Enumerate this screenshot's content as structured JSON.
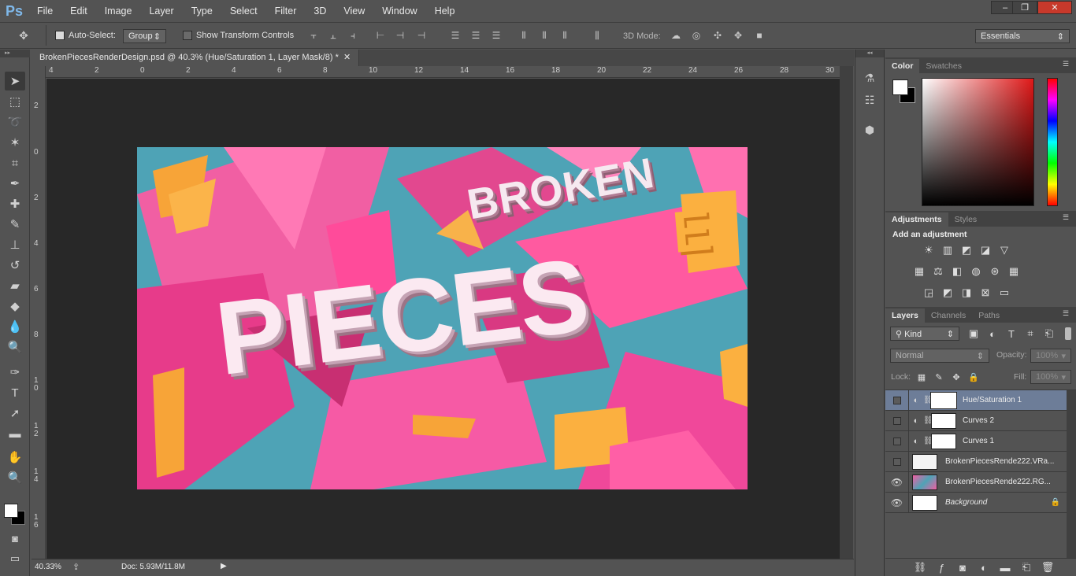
{
  "app": {
    "logo": "Ps"
  },
  "menu": [
    "File",
    "Edit",
    "Image",
    "Layer",
    "Type",
    "Select",
    "Filter",
    "3D",
    "View",
    "Window",
    "Help"
  ],
  "window_controls": {
    "minimize": "‒",
    "restore": "❐",
    "close": "✕"
  },
  "options": {
    "auto_select_label": "Auto-Select:",
    "auto_select_value": "Group",
    "show_transform_label": "Show Transform Controls",
    "mode_3d_label": "3D Mode:",
    "workspace": "Essentials"
  },
  "document": {
    "tab_title": "BrokenPiecesRenderDesign.psd @ 40.3% (Hue/Saturation 1, Layer Mask/8) *",
    "ruler_h": [
      "4",
      "2",
      "0",
      "2",
      "4",
      "6",
      "8",
      "10",
      "12",
      "14",
      "16",
      "18",
      "20",
      "22",
      "24",
      "26",
      "28",
      "30"
    ],
    "ruler_v": [
      "2",
      "0",
      "2",
      "4",
      "6",
      "8",
      "10",
      "12",
      "14",
      "16"
    ],
    "artwork": {
      "word1": "BROKEN",
      "word2": "PIECES",
      "extra_letter": "E"
    }
  },
  "status": {
    "zoom": "40.33%",
    "doc_info": "Doc: 5.93M/11.8M"
  },
  "color_panel": {
    "tabs": [
      "Color",
      "Swatches"
    ],
    "base_hue": "#e01818"
  },
  "adjustments_panel": {
    "tabs": [
      "Adjustments",
      "Styles"
    ],
    "heading": "Add an adjustment"
  },
  "layers_panel": {
    "tabs": [
      "Layers",
      "Channels",
      "Paths"
    ],
    "filter_kind": "Kind",
    "blend_mode": "Normal",
    "opacity_label": "Opacity:",
    "opacity_value": "100%",
    "lock_label": "Lock:",
    "fill_label": "Fill:",
    "fill_value": "100%",
    "layers": [
      {
        "name": "Hue/Saturation 1",
        "visible": false,
        "selected": true
      },
      {
        "name": "Curves 2",
        "visible": false,
        "selected": false
      },
      {
        "name": "Curves 1",
        "visible": false,
        "selected": false
      },
      {
        "name": "BrokenPiecesRende222.VRa...",
        "visible": false,
        "selected": false
      },
      {
        "name": "BrokenPiecesRende222.RG...",
        "visible": true,
        "selected": false
      },
      {
        "name": "Background",
        "visible": true,
        "selected": false
      }
    ]
  }
}
